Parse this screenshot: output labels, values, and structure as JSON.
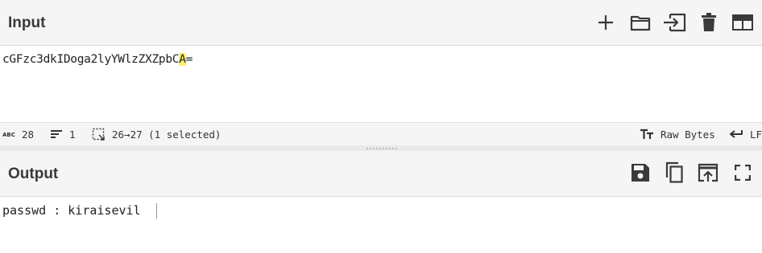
{
  "input": {
    "title": "Input",
    "text_before": "cGFzc3dkIDoga2lyYWlzZXZpbC",
    "text_selected": "A",
    "text_after": "=",
    "toolbar": {
      "add": "plus-icon",
      "open": "folder-icon",
      "load": "import-icon",
      "clear": "trash-icon",
      "layout": "layout-icon"
    }
  },
  "status": {
    "length_value": "28",
    "lines_value": "1",
    "selection_value": "26→27 (1 selected)",
    "encoding_label": "Raw Bytes",
    "eol_label": "LF"
  },
  "output": {
    "title": "Output",
    "text": "passwd : kiraisevil",
    "toolbar": {
      "save": "save-icon",
      "copy": "copy-icon",
      "replace_input": "replace-input-icon",
      "maximise": "maximise-icon"
    }
  },
  "colors": {
    "header_bg": "#f5f5f5",
    "highlight": "#fff06a",
    "icon": "#3a3a3a"
  }
}
